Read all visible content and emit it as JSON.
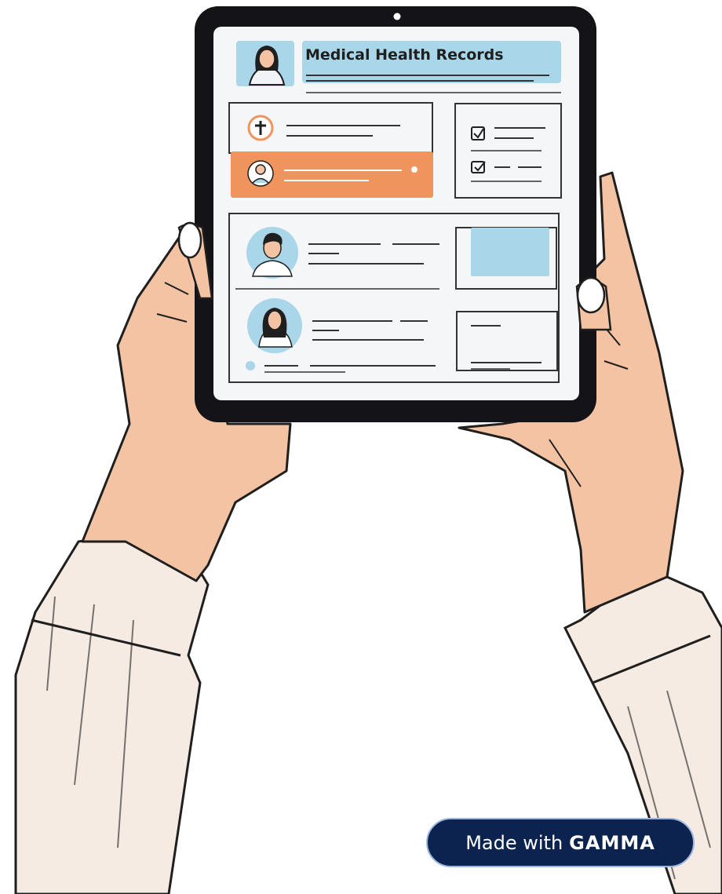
{
  "screen": {
    "title": "Medical Health Records"
  },
  "badge": {
    "made_with": "Made with",
    "brand": "GAMMA"
  },
  "colors": {
    "accent_orange": "#f0945e",
    "accent_blue": "#a9d6e8",
    "skin": "#f4c3a3",
    "sleeve": "#f6ebe3",
    "tablet_frame": "#141418",
    "badge_bg": "#0c2350"
  },
  "icons": [
    "patient-avatar-icon",
    "medical-cross-icon",
    "checkbox-icon",
    "user-avatar-icon"
  ]
}
